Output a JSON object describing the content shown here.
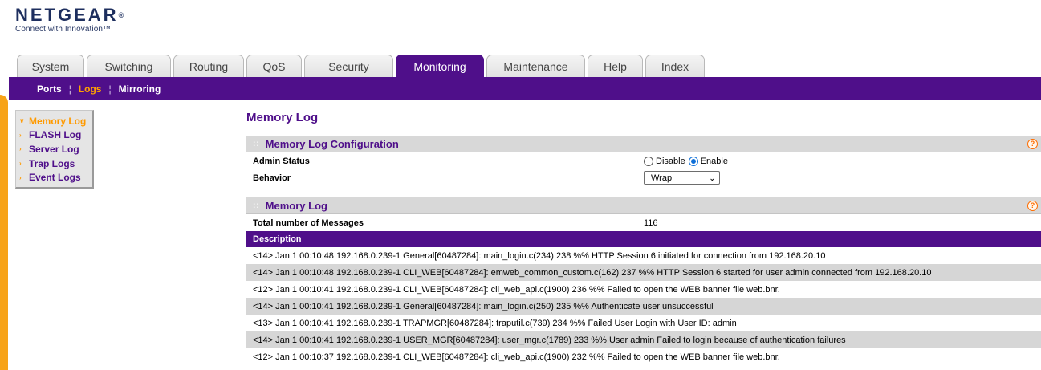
{
  "brand": {
    "name": "NETGEAR",
    "reg": "®",
    "tagline": "Connect with Innovation™"
  },
  "tabs": [
    {
      "label": "System",
      "active": false
    },
    {
      "label": "Switching",
      "active": false
    },
    {
      "label": "Routing",
      "active": false
    },
    {
      "label": "QoS",
      "active": false
    },
    {
      "label": "Security",
      "active": false
    },
    {
      "label": "Monitoring",
      "active": true
    },
    {
      "label": "Maintenance",
      "active": false
    },
    {
      "label": "Help",
      "active": false
    },
    {
      "label": "Index",
      "active": false
    }
  ],
  "subnav": [
    {
      "label": "Ports",
      "active": false
    },
    {
      "label": "Logs",
      "active": true
    },
    {
      "label": "Mirroring",
      "active": false
    }
  ],
  "sidemenu": [
    {
      "label": "Memory Log",
      "active": true
    },
    {
      "label": "FLASH Log",
      "active": false
    },
    {
      "label": "Server Log",
      "active": false
    },
    {
      "label": "Trap Logs",
      "active": false
    },
    {
      "label": "Event Logs",
      "active": false
    }
  ],
  "page_title": "Memory Log",
  "config": {
    "title": "Memory Log Configuration",
    "dots": "::",
    "help": "?",
    "admin_status_label": "Admin Status",
    "disable_label": "Disable",
    "enable_label": "Enable",
    "selected": "Enable",
    "behavior_label": "Behavior",
    "behavior_value": "Wrap"
  },
  "log": {
    "title": "Memory Log",
    "dots": "::",
    "help": "?",
    "total_label": "Total number of Messages",
    "total_value": "116",
    "description_header": "Description",
    "rows": [
      "<14> Jan 1 00:10:48 192.168.0.239-1 General[60487284]: main_login.c(234) 238 %% HTTP Session 6 initiated for connection from 192.168.20.10",
      "<14> Jan 1 00:10:48 192.168.0.239-1 CLI_WEB[60487284]: emweb_common_custom.c(162) 237 %% HTTP Session 6 started for user admin connected from 192.168.20.10",
      "<12> Jan 1 00:10:41 192.168.0.239-1 CLI_WEB[60487284]: cli_web_api.c(1900) 236 %% Failed to open the WEB banner file web.bnr.",
      "<14> Jan 1 00:10:41 192.168.0.239-1 General[60487284]: main_login.c(250) 235 %% Authenticate user unsuccessful",
      "<13> Jan 1 00:10:41 192.168.0.239-1 TRAPMGR[60487284]: traputil.c(739) 234 %% Failed User Login with User ID: admin",
      "<14> Jan 1 00:10:41 192.168.0.239-1 USER_MGR[60487284]: user_mgr.c(1789) 233 %% User admin Failed to login because of authentication failures",
      "<12> Jan 1 00:10:37 192.168.0.239-1 CLI_WEB[60487284]: cli_web_api.c(1900) 232 %% Failed to open the WEB banner file web.bnr."
    ]
  }
}
